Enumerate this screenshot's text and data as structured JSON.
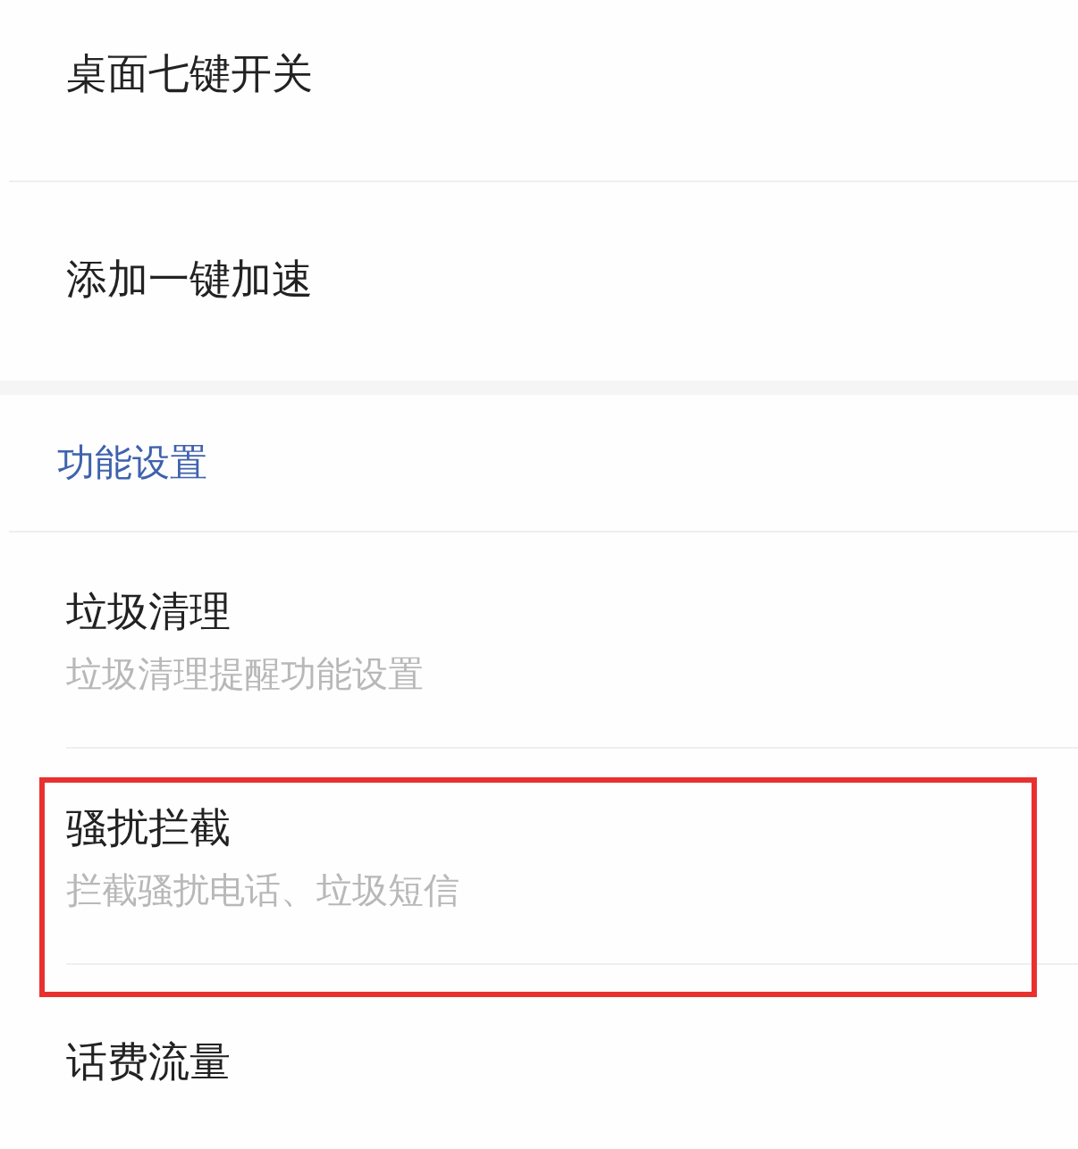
{
  "groups": [
    {
      "items": [
        {
          "title": "桌面七键开关",
          "highlighted": false
        },
        {
          "title": "添加一键加速",
          "highlighted": false
        }
      ]
    },
    {
      "header": "功能设置",
      "items": [
        {
          "title": "垃圾清理",
          "subtitle": "垃圾清理提醒功能设置",
          "highlighted": false
        },
        {
          "title": "骚扰拦截",
          "subtitle": "拦截骚扰电话、垃圾短信",
          "highlighted": true
        },
        {
          "title": "话费流量",
          "highlighted": false
        }
      ]
    }
  ]
}
